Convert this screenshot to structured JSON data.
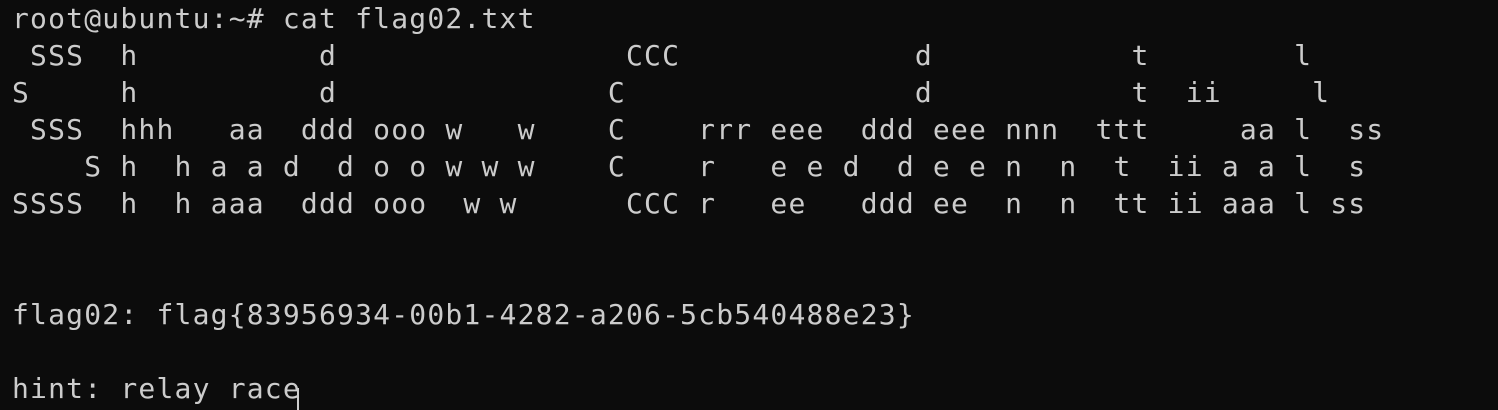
{
  "terminal": {
    "prompt": "root@ubuntu:~# cat flag02.txt",
    "banner": [
      " SSS  h          d                CCC             d           t        l",
      "S     h          d               C                d           t  ii     l",
      " SSS  hhh   aa  ddd ooo w   w    C    rrr eee  ddd eee nnn  ttt     aa l  ss",
      "    S h  h a a d  d o o w w w    C    r   e e d  d e e n  n  t  ii a a l  s",
      "SSSS  h  h aaa  ddd ooo  w w      CCC r   ee   ddd ee  n  n  tt ii aaa l ss"
    ],
    "flag_line": "flag02: flag{83956934-00b1-4282-a206-5cb540488e23}",
    "hint_line": "hint: relay race"
  },
  "colors": {
    "background": "#0c0c0c",
    "foreground": "#cccccc"
  }
}
